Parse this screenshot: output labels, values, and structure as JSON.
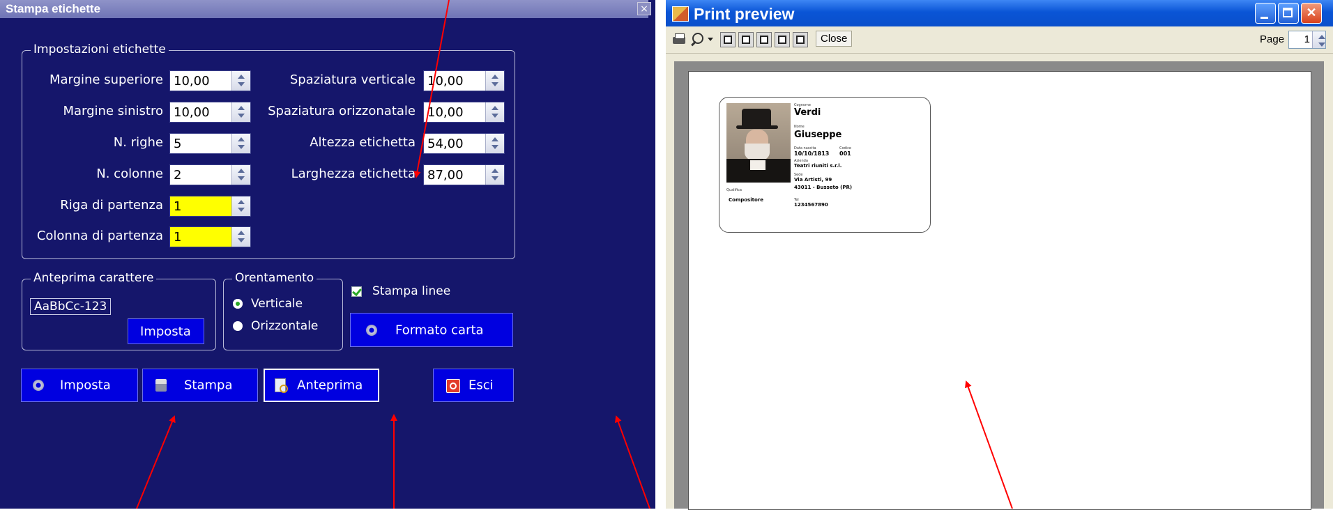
{
  "dialog": {
    "title": "Stampa etichette",
    "close_glyph": "×",
    "settings_group": {
      "title": "Impostazioni etichette",
      "fields": [
        {
          "label": "Margine superiore",
          "value": "10,00"
        },
        {
          "label": "Margine sinistro",
          "value": "10,00"
        },
        {
          "label": "N. righe",
          "value": "5"
        },
        {
          "label": "N. colonne",
          "value": "2"
        },
        {
          "label": "Riga di partenza",
          "value": "1"
        },
        {
          "label": "Colonna di partenza",
          "value": "1"
        },
        {
          "label": "Spaziatura verticale",
          "value": "10,00"
        },
        {
          "label": "Spaziatura orizzonatale",
          "value": "10,00"
        },
        {
          "label": "Altezza etichetta",
          "value": "54,00"
        },
        {
          "label": "Larghezza etichetta",
          "value": "87,00"
        }
      ]
    },
    "font_group": {
      "title": "Anteprima carattere",
      "sample": "AaBbCc-123",
      "button": "Imposta"
    },
    "orientation_group": {
      "title": "Orentamento",
      "options": [
        "Verticale",
        "Orizzontale"
      ],
      "selected": "Verticale"
    },
    "print_lines": {
      "label": "Stampa linee",
      "checked": true
    },
    "paper_button": "Formato carta",
    "buttons": {
      "setup": "Imposta",
      "print": "Stampa",
      "preview": "Anteprima",
      "exit": "Esci"
    }
  },
  "preview_window": {
    "title": "Print preview",
    "toolbar": {
      "close": "Close",
      "page_label": "Page",
      "page_value": "1",
      "icons": [
        "printer-icon",
        "zoom-icon",
        "one-page-icon",
        "two-pages-icon",
        "three-pages-icon",
        "four-pages-icon",
        "six-pages-icon"
      ]
    },
    "window_buttons": [
      "minimize-icon",
      "maximize-icon",
      "close-icon"
    ],
    "label": {
      "surname_caption": "Cognome",
      "surname": "Verdi",
      "name_caption": "Nome",
      "name": "Giuseppe",
      "birth_caption": "Data nascita",
      "birth_date": "10/10/1813",
      "code_caption": "Codice",
      "code": "001",
      "company_caption": "Azienda",
      "company": "Teatri riuniti s.r.l.",
      "address_caption": "Sede",
      "street": "Via Artisti, 99",
      "city": "43011 - Busseto (PR)",
      "role_caption": "Qualifica",
      "role": "Compositore",
      "phone_caption": "Tel",
      "phone": "1234567890"
    }
  }
}
